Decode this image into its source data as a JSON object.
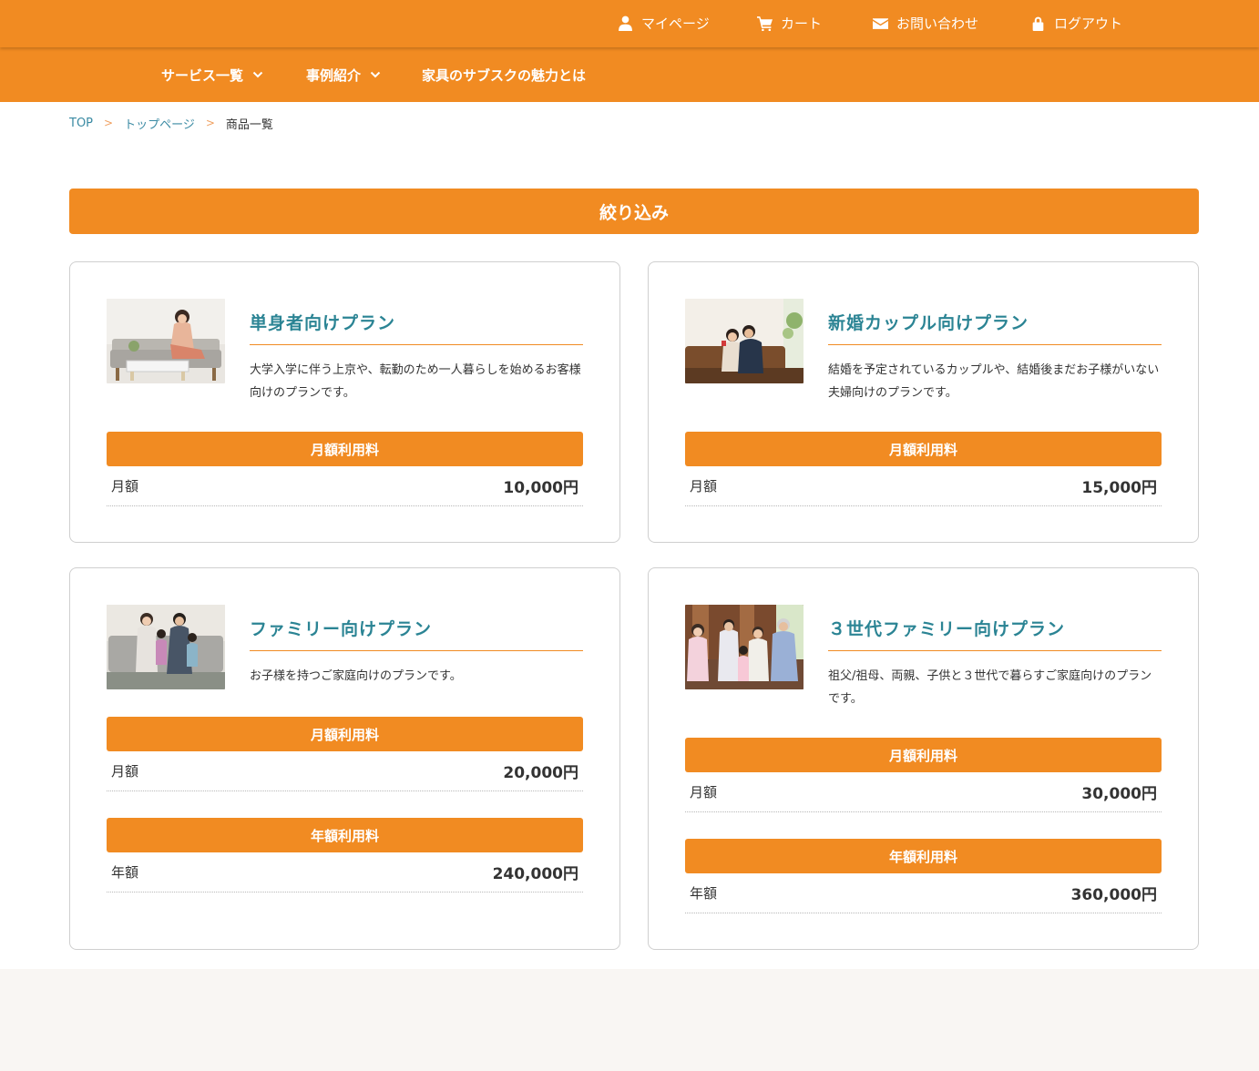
{
  "header": {
    "util_links": [
      {
        "label": "マイページ",
        "icon": "user-icon"
      },
      {
        "label": "カート",
        "icon": "cart-icon"
      },
      {
        "label": "お問い合わせ",
        "icon": "mail-icon"
      },
      {
        "label": "ログアウト",
        "icon": "lock-icon"
      }
    ],
    "nav": [
      {
        "label": "サービス一覧",
        "icon": "chevron-down-icon"
      },
      {
        "label": "事例紹介",
        "icon": "chevron-down-icon"
      },
      {
        "label": "家具のサブスクの魅力とは"
      }
    ]
  },
  "breadcrumb": {
    "items": [
      "TOP",
      "トップページ",
      "商品一覧"
    ],
    "separator": ">"
  },
  "filter": {
    "label": "絞り込み"
  },
  "plans": [
    {
      "title": "単身者向けプラン",
      "description": "大学入学に伴う上京や、転勤のため一人暮らしを始めるお客様向けのプランです。",
      "prices": [
        {
          "heading": "月額利用料",
          "label": "月額",
          "value": "10,000円"
        }
      ]
    },
    {
      "title": "新婚カップル向けプラン",
      "description": "結婚を予定されているカップルや、結婚後まだお子様がいない夫婦向けのプランです。",
      "prices": [
        {
          "heading": "月額利用料",
          "label": "月額",
          "value": "15,000円"
        }
      ]
    },
    {
      "title": "ファミリー向けプラン",
      "description": "お子様を持つご家庭向けのプランです。",
      "prices": [
        {
          "heading": "月額利用料",
          "label": "月額",
          "value": "20,000円"
        },
        {
          "heading": "年額利用料",
          "label": "年額",
          "value": "240,000円"
        }
      ]
    },
    {
      "title": "３世代ファミリー向けプラン",
      "description": "祖父/祖母、両親、子供と３世代で暮らすご家庭向けのプランです。",
      "prices": [
        {
          "heading": "月額利用料",
          "label": "月額",
          "value": "30,000円"
        },
        {
          "heading": "年額利用料",
          "label": "年額",
          "value": "360,000円"
        }
      ]
    }
  ],
  "colors": {
    "brand_orange": "#f18b22",
    "title_teal": "#2b8494",
    "link_blue": "#3a8aa3",
    "footer_bg": "#f9f6f3"
  }
}
